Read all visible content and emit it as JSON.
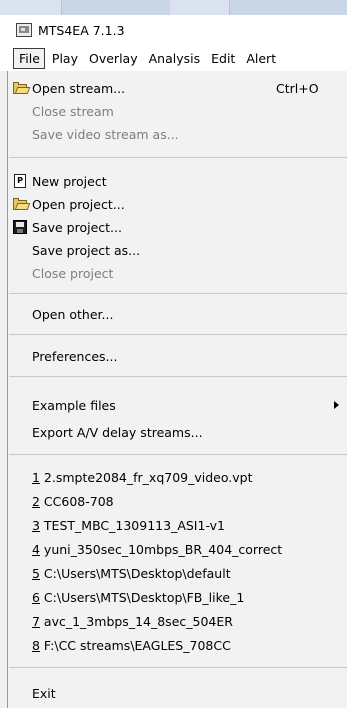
{
  "window": {
    "title": "MTS4EA 7.1.3",
    "icon": "app-icon"
  },
  "menubar": {
    "items": [
      {
        "label": "File",
        "active": true
      },
      {
        "label": "Play"
      },
      {
        "label": "Overlay"
      },
      {
        "label": "Analysis"
      },
      {
        "label": "Edit"
      },
      {
        "label": "Alert"
      }
    ]
  },
  "file_menu": {
    "open_stream": {
      "label": "Open stream...",
      "shortcut": "Ctrl+O",
      "icon": "open-folder-icon"
    },
    "close_stream": {
      "label": "Close stream",
      "disabled": true
    },
    "save_video_stream_as": {
      "label": "Save video stream as...",
      "disabled": true
    },
    "new_project": {
      "label": "New project",
      "icon": "new-project-icon",
      "icon_letter": "P"
    },
    "open_project": {
      "label": "Open project...",
      "icon": "open-folder-icon"
    },
    "save_project": {
      "label": "Save project...",
      "icon": "save-disk-icon"
    },
    "save_project_as": {
      "label": "Save project as..."
    },
    "close_project": {
      "label": "Close project",
      "disabled": true
    },
    "open_other": {
      "label": "Open other..."
    },
    "preferences": {
      "label": "Preferences..."
    },
    "example_files": {
      "label": "Example files",
      "icon": "submenu-arrow-icon"
    },
    "export_av_delay": {
      "label": "Export A/V delay streams..."
    },
    "recent_files": [
      {
        "num": "1",
        "label": " 2.smpte2084_fr_xq709_video.vpt"
      },
      {
        "num": "2",
        "label": " CC608-708"
      },
      {
        "num": "3",
        "label": " TEST_MBC_1309113_ASI1-v1"
      },
      {
        "num": "4",
        "label": " yuni_350sec_10mbps_BR_404_correct"
      },
      {
        "num": "5",
        "label": " C:\\Users\\MTS\\Desktop\\default"
      },
      {
        "num": "6",
        "label": " C:\\Users\\MTS\\Desktop\\FB_like_1"
      },
      {
        "num": "7",
        "label": " avc_1_3mbps_14_8sec_504ER"
      },
      {
        "num": "8",
        "label": " F:\\CC streams\\EAGLES_708CC"
      }
    ],
    "exit": {
      "label": "Exit"
    }
  }
}
